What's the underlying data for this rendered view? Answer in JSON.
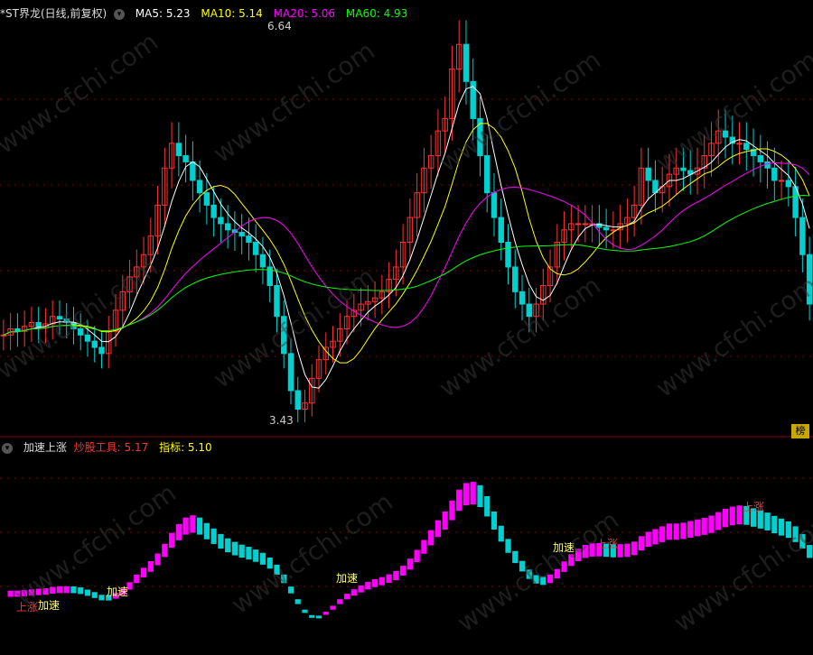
{
  "header": {
    "title": "*ST界龙(日线,前复权)",
    "ma": [
      {
        "label": "MA5: 5.23",
        "color": "#ffffff"
      },
      {
        "label": "MA10: 5.14",
        "color": "#ffff00"
      },
      {
        "label": "MA20: 5.06",
        "color": "#ff00ff"
      },
      {
        "label": "MA60: 4.93",
        "color": "#00ff00"
      }
    ]
  },
  "price_annotations": {
    "high": "6.64",
    "low": "3.43"
  },
  "indicator_header": {
    "name": "加速上涨",
    "items": [
      {
        "label": "炒股工具: 5.17",
        "color": "#ff3333"
      },
      {
        "label": "指标: 5.10",
        "color": "#ffff00"
      }
    ]
  },
  "rank_badge": "榜",
  "signals": [
    "上涨",
    "加速",
    "加速",
    "加速",
    "加速",
    "上涨",
    "上涨"
  ],
  "watermark": "www.cfchi.com",
  "colors": {
    "up": "#ff3333",
    "down": "#00d0d0",
    "ma5": "#ffffff",
    "ma10": "#ffff00",
    "ma20": "#ff00ff",
    "ma60": "#00ff00",
    "grid": "#8b0000"
  },
  "chart_data": {
    "type": "candlestick",
    "price_range": [
      3.43,
      6.64
    ],
    "ma_last": {
      "MA5": 5.23,
      "MA10": 5.14,
      "MA20": 5.06,
      "MA60": 4.93
    },
    "close": [
      4.15,
      4.2,
      4.18,
      4.22,
      4.25,
      4.21,
      4.24,
      4.3,
      4.28,
      4.25,
      4.2,
      4.15,
      4.1,
      4.05,
      4.0,
      4.18,
      4.35,
      4.5,
      4.62,
      4.7,
      4.8,
      4.95,
      5.2,
      5.5,
      5.7,
      5.6,
      5.55,
      5.4,
      5.3,
      5.2,
      5.1,
      5.05,
      5.0,
      4.98,
      4.95,
      4.9,
      4.8,
      4.7,
      4.55,
      4.3,
      4.0,
      3.7,
      3.55,
      3.6,
      3.8,
      3.95,
      4.05,
      4.1,
      4.2,
      4.3,
      4.35,
      4.4,
      4.42,
      4.45,
      4.5,
      4.6,
      4.7,
      4.9,
      5.1,
      5.3,
      5.5,
      5.6,
      5.8,
      5.9,
      6.3,
      6.5,
      6.2,
      5.9,
      5.6,
      5.3,
      5.1,
      4.9,
      4.7,
      4.5,
      4.4,
      4.3,
      4.4,
      4.55,
      4.7,
      4.9,
      5.0,
      5.05,
      5.05,
      5.05,
      5.05,
      5.02,
      5.0,
      5.0,
      5.05,
      5.1,
      5.2,
      5.5,
      5.4,
      5.3,
      5.35,
      5.45,
      5.5,
      5.48,
      5.45,
      5.5,
      5.6,
      5.7,
      5.8,
      5.75,
      5.7,
      5.7,
      5.65,
      5.6,
      5.55,
      5.5,
      5.4,
      5.4,
      5.35,
      5.1,
      4.8,
      4.4
    ]
  }
}
